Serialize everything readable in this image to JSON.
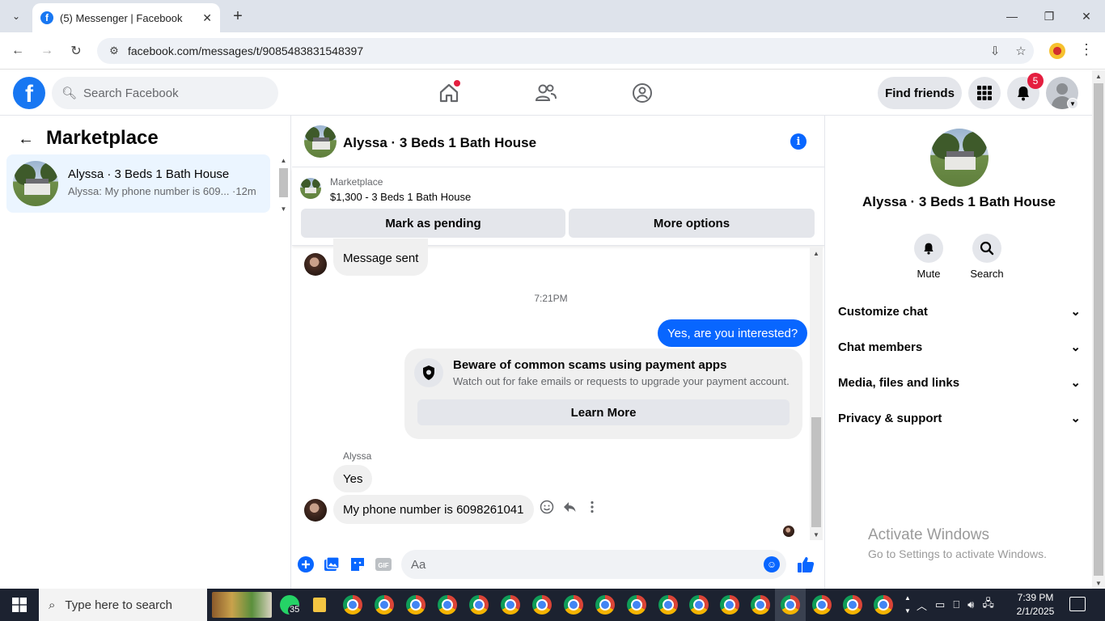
{
  "browser": {
    "tab_title": "(5) Messenger | Facebook",
    "url": "facebook.com/messages/t/9085483831548397"
  },
  "fb": {
    "search_placeholder": "Search Facebook",
    "find_friends": "Find friends",
    "notification_count": "5"
  },
  "left": {
    "title": "Marketplace",
    "conversation": {
      "name": "Alyssa · 3 Beds 1 Bath House",
      "snippet": "Alyssa: My phone number is 609...",
      "time": " ·12m"
    }
  },
  "chat": {
    "name": "Alyssa · 3 Beds 1 Bath House",
    "listing_category": "Marketplace",
    "listing_price": "$1,300 - 3 Beds 1 Bath House",
    "mark_pending": "Mark as pending",
    "more_options": "More options",
    "messages": {
      "sent_status": "Message sent",
      "timestamp": "7:21PM",
      "outgoing": "Yes, are you interested?",
      "scam_title": "Beware of common scams using payment apps",
      "scam_desc": "Watch out for fake emails or requests to upgrade your payment account.",
      "learn_more": "Learn More",
      "sender": "Alyssa",
      "reply1": "Yes",
      "reply2": "My phone number is 6098261041"
    },
    "composer_placeholder": "Aa"
  },
  "right": {
    "name": "Alyssa · 3 Beds 1 Bath House",
    "mute": "Mute",
    "search": "Search",
    "sections": [
      "Customize chat",
      "Chat members",
      "Media, files and links",
      "Privacy & support"
    ],
    "watermark_line1": "Activate Windows",
    "watermark_line2": "Go to Settings to activate Windows."
  },
  "taskbar": {
    "search_placeholder": "Type here to search",
    "whatsapp_badge": "35",
    "time": "7:39 PM",
    "date": "2/1/2025"
  },
  "colors": {
    "fb_blue": "#1877f2",
    "messenger_blue": "#0866ff",
    "selected_row": "#ebf5ff",
    "notification_red": "#e41e3f"
  }
}
